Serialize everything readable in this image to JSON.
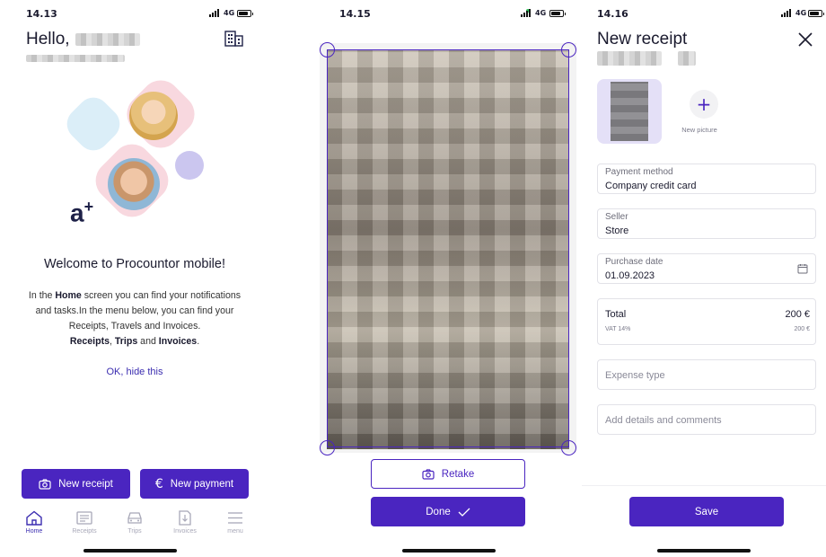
{
  "screen1": {
    "time": "14.13",
    "network": "4G",
    "greeting": "Hello,",
    "welcome_title": "Welcome to Procountor mobile!",
    "desc_1": "In the ",
    "desc_home": "Home",
    "desc_2": " screen you can find your notifications and tasks.In the menu below, you can find your Receipts, Travels and Invoices.",
    "desc_receipts": "Receipts",
    "desc_comma": ", ",
    "desc_trips": "Trips",
    "desc_and": " and ",
    "desc_invoices": "Invoices",
    "desc_end": ".",
    "hide_link": "OK, hide this",
    "brand_mark": "a",
    "brand_plus": "+",
    "new_receipt": "New receipt",
    "new_payment": "New payment",
    "tabs": [
      {
        "label": "Home",
        "icon": "home-icon"
      },
      {
        "label": "Receipts",
        "icon": "receipt-icon"
      },
      {
        "label": "Trips",
        "icon": "car-icon"
      },
      {
        "label": "Invoices",
        "icon": "invoice-icon"
      },
      {
        "label": "menu",
        "icon": "menu-icon"
      }
    ]
  },
  "screen2": {
    "time": "14.15",
    "network": "4G",
    "retake": "Retake",
    "done": "Done"
  },
  "screen3": {
    "time": "14.16",
    "network": "4G",
    "title": "New receipt",
    "new_picture": "New picture",
    "payment_method_label": "Payment method",
    "payment_method_value": "Company credit card",
    "seller_label": "Seller",
    "seller_value": "Store",
    "purchase_date_label": "Purchase date",
    "purchase_date_value": "01.09.2023",
    "total_label": "Total",
    "total_value": "200 €",
    "vat_label": "VAT 14%",
    "vat_value": "200 €",
    "expense_type_placeholder": "Expense type",
    "details_placeholder": "Add details and comments",
    "save": "Save"
  },
  "colors": {
    "accent": "#4a25c0",
    "link": "#3b2db0"
  }
}
